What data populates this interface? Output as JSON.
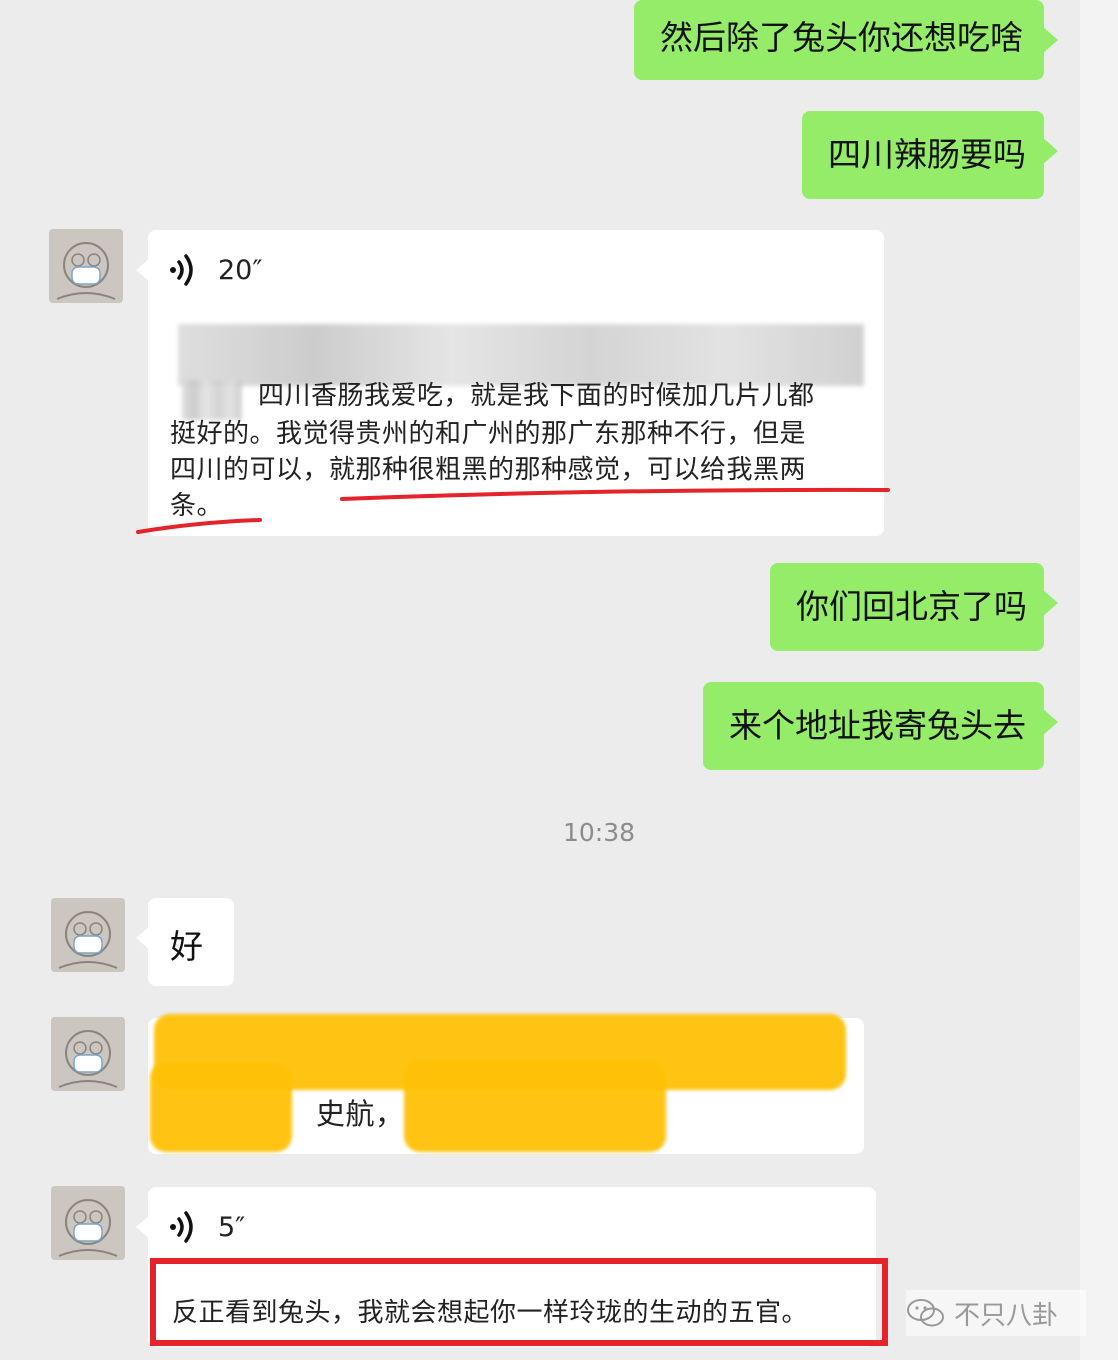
{
  "messages_out": [
    {
      "text": "然后除了兔头你还想吃啥"
    },
    {
      "text": "四川辣肠要吗"
    },
    {
      "text": "你们回北京了吗"
    },
    {
      "text": "来个地址我寄兔头去"
    }
  ],
  "voice_1": {
    "duration": "20″",
    "transcript_line1": "四川香肠我爱吃，就是我下面的时候加几片儿都",
    "transcript_line2": "挺好的。我觉得贵州的和广州的那广东那种不行，但是",
    "transcript_line3a": "四川的可以，",
    "transcript_line3b": "就那种很粗黑的那种感觉，可以给我黑两",
    "transcript_line4": "条。"
  },
  "timestamp": "10:38",
  "reply_ok": "好",
  "redacted_msg": {
    "visible_text": "史航，"
  },
  "voice_2": {
    "duration": "5″",
    "transcript": "反正看到兔头，我就会想起你一样玲珑的生动的五官。"
  },
  "watermark": {
    "text": "不只八卦",
    "icon": "wechat-icon"
  },
  "colors": {
    "green_bubble": "#95ec69",
    "highlight": "#ffc107",
    "annotation_red": "#e5232a",
    "background": "#ececec"
  }
}
